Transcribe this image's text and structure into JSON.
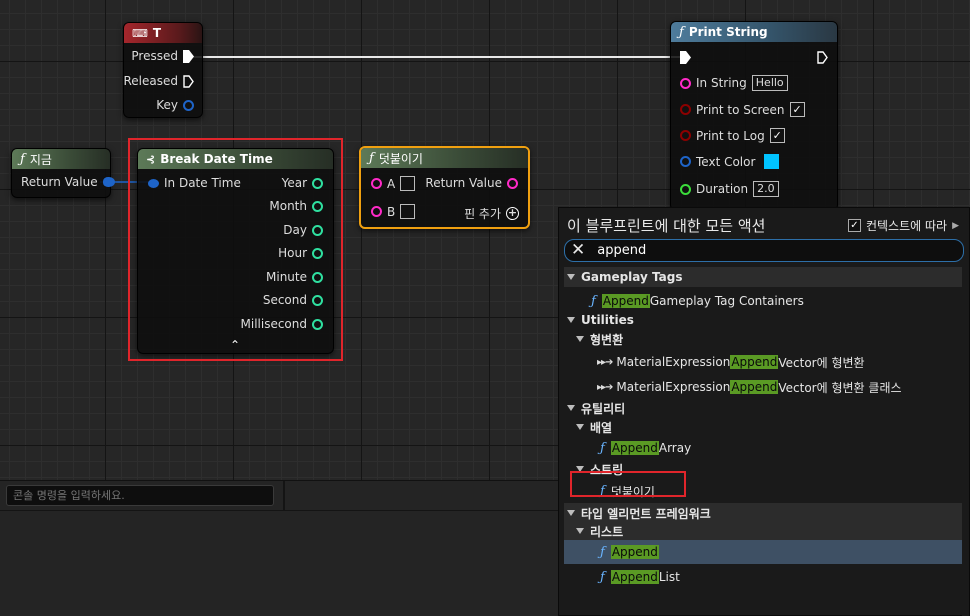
{
  "nodes": {
    "key_t": {
      "title": "T",
      "pins": [
        "Pressed",
        "Released",
        "Key"
      ]
    },
    "now": {
      "title": "지금",
      "pin": "Return Value"
    },
    "break_date": {
      "title": "Break Date Time",
      "input": "In Date Time",
      "outputs": [
        "Year",
        "Month",
        "Day",
        "Hour",
        "Minute",
        "Second",
        "Millisecond"
      ]
    },
    "append": {
      "title": "덧붙이기",
      "a": "A",
      "b": "B",
      "return": "Return Value",
      "add_pin": "핀 추가"
    },
    "print": {
      "title": "Print String",
      "in_string": "In String",
      "in_string_value": "Hello",
      "print_screen": "Print to Screen",
      "print_log": "Print to Log",
      "text_color": "Text Color",
      "duration": "Duration",
      "duration_value": "2.0"
    }
  },
  "console": {
    "placeholder": "콘솔 명령을 입력하세요."
  },
  "menu": {
    "title": "이 블루프린트에 대한 모든 액션",
    "context_label": "컨텍스트에 따라",
    "search_value": "append",
    "highlight": "Append",
    "gameplay_tags": "Gameplay Tags",
    "gameplay_item_rest": " Gameplay Tag Containers",
    "utilities": "Utilities",
    "conversion": "형변환",
    "mat1_pre": "MaterialExpression",
    "mat1_post": "Vector에 형변환",
    "mat2_pre": "MaterialExpression",
    "mat2_post": "Vector에 형변환 클래스",
    "utility_kr": "유틸리티",
    "array_cat": "배열",
    "array_rest": " Array",
    "string_cat": "스트링",
    "string_item": "덧붙이기",
    "type_element": "타입 엘리먼트 프레임워크",
    "list_cat": "리스트",
    "list_rest": " List"
  },
  "colors": {
    "exec": "#ffffff",
    "struct_pin": "#1e64c8",
    "int_pin": "#2fe0a0",
    "string_pin": "#ff2ac8",
    "bool_pin": "#8c0000",
    "linear_color": "#00c3ff",
    "float_pin": "#3bdc3b",
    "highlight_box": "#e0252b",
    "search_highlight": "#5a9a24"
  }
}
